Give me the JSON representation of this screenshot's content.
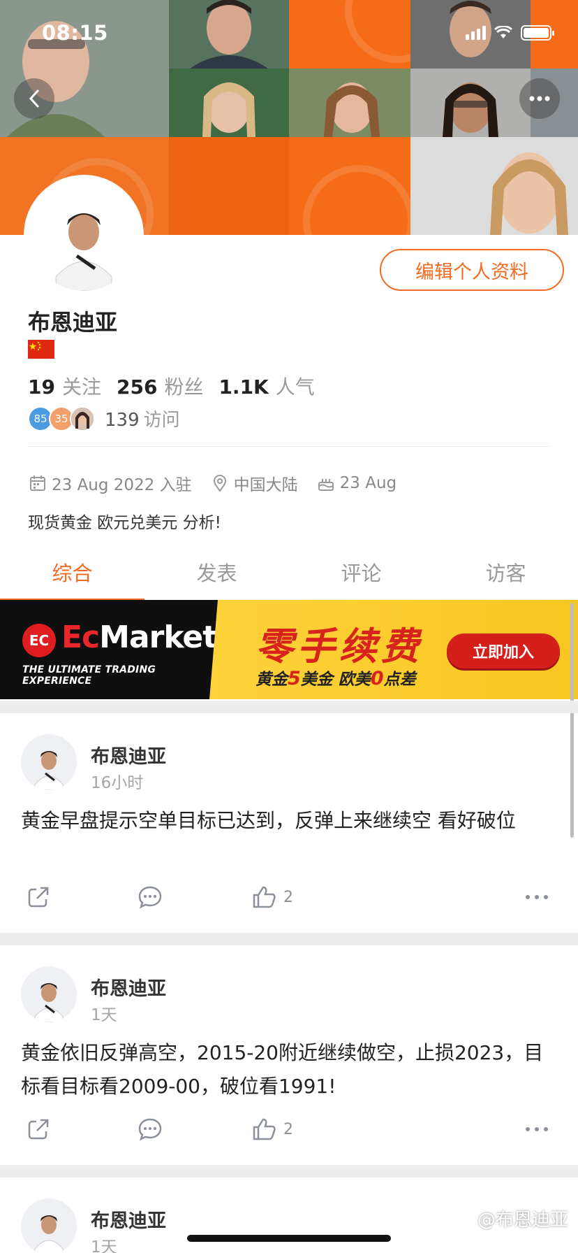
{
  "status_bar": {
    "time": "08:15"
  },
  "profile": {
    "name": "布恩迪亚",
    "edit_label": "编辑个人资料",
    "following_count": "19",
    "following_label": "关注",
    "followers_count": "256",
    "followers_label": "粉丝",
    "popularity_count": "1.1K",
    "popularity_label": "人气",
    "visitor_badges": [
      "85",
      "35"
    ],
    "visit_count": "139",
    "visit_label": "访问",
    "joined": "23 Aug 2022 入驻",
    "location": "中国大陆",
    "birthday": "23 Aug",
    "bio": "现货黄金 欧元兑美元 分析!"
  },
  "tabs": [
    {
      "label": "综合",
      "active": true
    },
    {
      "label": "发表",
      "active": false
    },
    {
      "label": "评论",
      "active": false
    },
    {
      "label": "访客",
      "active": false
    }
  ],
  "banner": {
    "brand_logo_text": "EC",
    "brand_prefix": "Ec",
    "brand_suffix": "Markets",
    "tagline": "THE ULTIMATE TRADING EXPERIENCE",
    "headline": "零手续费",
    "sub_a": "黄金",
    "sub_num1": "5",
    "sub_b": "美金 欧美",
    "sub_num2": "0",
    "sub_c": "点差",
    "cta": "立即加入"
  },
  "posts": [
    {
      "author": "布恩迪亚",
      "time": "16小时",
      "text": "黄金早盘提示空单目标已达到，反弹上来继续空 看好破位",
      "likes": "2"
    },
    {
      "author": "布恩迪亚",
      "time": "1天",
      "text": "黄金依旧反弹高空，2015-20附近继续做空，止损2023，目标看目标看2009-00，破位看1991!",
      "likes": "2"
    },
    {
      "author": "布恩迪亚",
      "time": "1天"
    }
  ],
  "watermark": "@布恩迪亚",
  "colors": {
    "accent": "#f36b21",
    "banner_yellow": "#fdd23a",
    "banner_red": "#d8231d"
  }
}
